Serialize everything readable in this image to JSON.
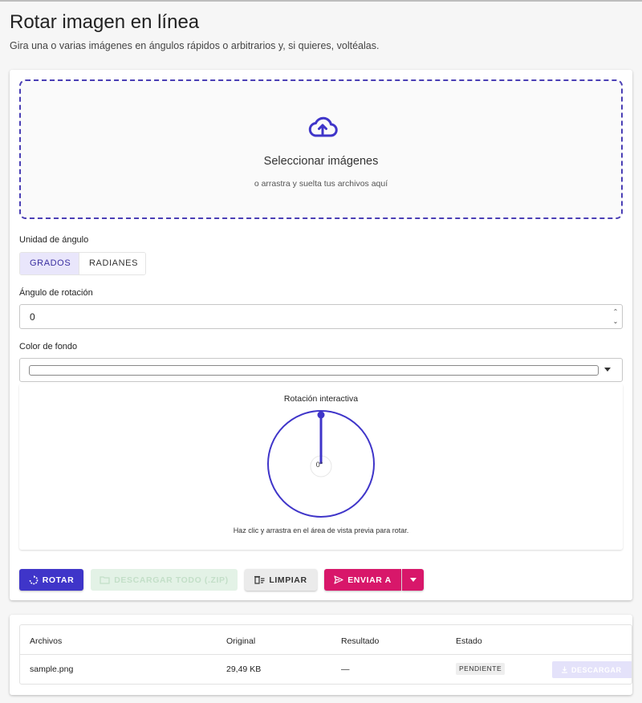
{
  "header": {
    "title": "Rotar imagen en línea",
    "subtitle": "Gira una o varias imágenes en ángulos rápidos o arbitrarios y, si quieres, voltéalas."
  },
  "dropzone": {
    "icon": "cloud-upload-icon",
    "title": "Seleccionar imágenes",
    "subtitle": "o arrastra y suelta tus archivos aquí"
  },
  "angle_unit": {
    "label": "Unidad de ángulo",
    "options": [
      "GRADOS",
      "RADIANES"
    ],
    "selected": "GRADOS"
  },
  "rotation_angle": {
    "label": "Ángulo de rotación",
    "value": "0"
  },
  "background_color": {
    "label": "Color de fondo",
    "value_color": "#ffffff"
  },
  "preview": {
    "title": "Rotación interactiva",
    "angle_readout": "0°",
    "hint": "Haz clic y arrastra en el área de vista previa para rotar.",
    "accent": "#3f35c9"
  },
  "actions": {
    "rotate": "ROTAR",
    "download_zip": "DESCARGAR TODO (.ZIP)",
    "clear": "LIMPIAR",
    "send_to": "ENVIAR A"
  },
  "files_table": {
    "columns": [
      "Archivos",
      "Original",
      "Resultado",
      "Estado"
    ],
    "rows": [
      {
        "name": "sample.png",
        "original": "29,49 KB",
        "result": "—",
        "status": "PENDIENTE",
        "action": "DESCARGAR"
      }
    ]
  },
  "colors": {
    "primary": "#3f35c9",
    "send": "#d8176a",
    "zip_disabled": "#e3f2e6"
  }
}
